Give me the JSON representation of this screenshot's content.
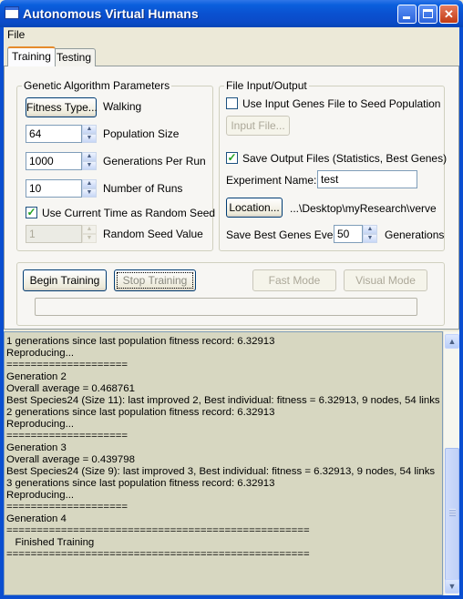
{
  "window": {
    "title": "Autonomous Virtual Humans",
    "minimize_icon": "minimize-icon",
    "maximize_icon": "maximize-icon",
    "close_icon": "close-icon"
  },
  "menu": {
    "file": "File"
  },
  "tabs": [
    {
      "label": "Training",
      "selected": true
    },
    {
      "label": "Testing",
      "selected": false
    }
  ],
  "ga": {
    "legend": "Genetic Algorithm Parameters",
    "fitness_button": "Fitness Type...",
    "fitness_value": "Walking",
    "population_size": "64",
    "population_label": "Population Size",
    "generations": "1000",
    "generations_label": "Generations Per Run",
    "runs": "10",
    "runs_label": "Number of Runs",
    "use_time_seed_label": "Use Current Time as Random Seed",
    "use_time_seed_checked": true,
    "seed_value": "1",
    "seed_label": "Random Seed Value"
  },
  "io": {
    "legend": "File Input/Output",
    "use_input_label": "Use Input Genes File to Seed Population",
    "use_input_checked": false,
    "input_file_button": "Input File...",
    "save_output_label": "Save Output Files (Statistics, Best Genes)",
    "save_output_checked": true,
    "experiment_name_label": "Experiment Name:",
    "experiment_name": "test",
    "location_button": "Location...",
    "location_path": "...\\Desktop\\myResearch\\verve",
    "save_best_label": "Save Best Genes Every",
    "save_best_value": "50",
    "save_best_unit": "Generations"
  },
  "controls": {
    "begin": "Begin Training",
    "stop": "Stop Training",
    "fast": "Fast Mode",
    "visual": "Visual Mode",
    "progress": 0
  },
  "log": [
    "1 generations since last population fitness record: 6.32913",
    "Reproducing...",
    "====================",
    "Generation 2",
    "Overall average = 0.468761",
    "Best Species24 (Size 11): last improved 2, Best individual: fitness = 6.32913, 9 nodes, 54 links",
    "2 generations since last population fitness record: 6.32913",
    "Reproducing...",
    "====================",
    "Generation 3",
    "Overall average = 0.439798",
    "Best Species24 (Size 9): last improved 3, Best individual: fitness = 6.32913, 9 nodes, 54 links",
    "3 generations since last population fitness record: 6.32913",
    "Reproducing...",
    "====================",
    "Generation 4",
    "==================================================",
    "   Finished Training",
    "=================================================="
  ],
  "colors": {
    "titlebar": "#0a51d0",
    "log_background": "#d7d7c1",
    "checkmark": "#21a121"
  }
}
